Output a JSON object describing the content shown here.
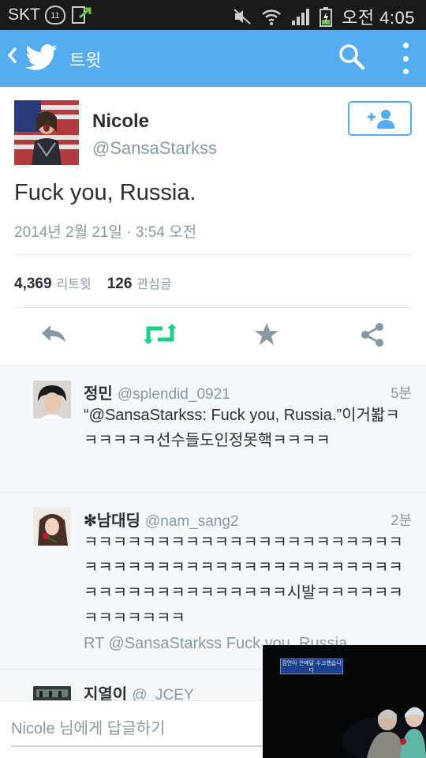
{
  "status_bar": {
    "carrier": "SKT",
    "badge": "11",
    "time": "오전 4:05"
  },
  "action_bar": {
    "title": "트윗",
    "back_icon": "chevron-left-icon",
    "logo_icon": "twitter-bird-icon",
    "search_icon": "search-icon",
    "more_icon": "overflow-menu-icon"
  },
  "tweet": {
    "user": {
      "name": "Nicole",
      "handle": "@SansaStarkss"
    },
    "follow_icon": "add-user-icon",
    "text": "Fuck you, Russia.",
    "timestamp": "2014년 2월 21일 · 3:54 오전",
    "stats": {
      "retweets_count": "4,369",
      "retweets_label": "리트윗",
      "favorites_count": "126",
      "favorites_label": "관심글"
    },
    "actions": [
      "reply-icon",
      "retweet-icon",
      "favorite-star-icon",
      "share-icon"
    ]
  },
  "replies": [
    {
      "name": "정민",
      "handle": "@splendid_0921",
      "time": "5분",
      "text": "“@SansaStarkss: Fuck you, Russia.”이거봛ㅋㅋㅋㅋㅋㅋ선수들도인정못핵ㅋㅋㅋㅋ"
    },
    {
      "name": "✻남대딩",
      "handle": "@nam_sang2",
      "time": "2분",
      "text": "ㅋㅋㅋㅋㅋㅋㅋㅋㅋㅋㅋㅋㅋㅋㅋㅋㅋㅋㅋㅋㅋㅋㅋㅋㅋㅋㅋㅋㅋㅋㅋㅋㅋㅋㅋㅋㅋㅋㅋㅋㅋㅋㅋㅋㅋㅋㅋㅋㅋㅋㅋㅋㅋㅋㅋㅋㅋㅋ시발ㅋㅋㅋㅋㅋㅋㅋㅋㅋㅋㅋㅋㅋ",
      "rt_line": "RT @SansaStarkss Fuck you, Russia"
    },
    {
      "name": "지열이",
      "handle": "@_JCEY"
    }
  ],
  "reply_bar": {
    "placeholder": "Nicole 님에게 답글하기"
  },
  "video_overlay": {
    "caption": "김연아 은메달 수고했습니다"
  },
  "colors": {
    "brand_blue": "#55acee",
    "retweet_green": "#19cf86",
    "muted_text": "#8899a6",
    "status_bar": "#1a1a1a"
  }
}
